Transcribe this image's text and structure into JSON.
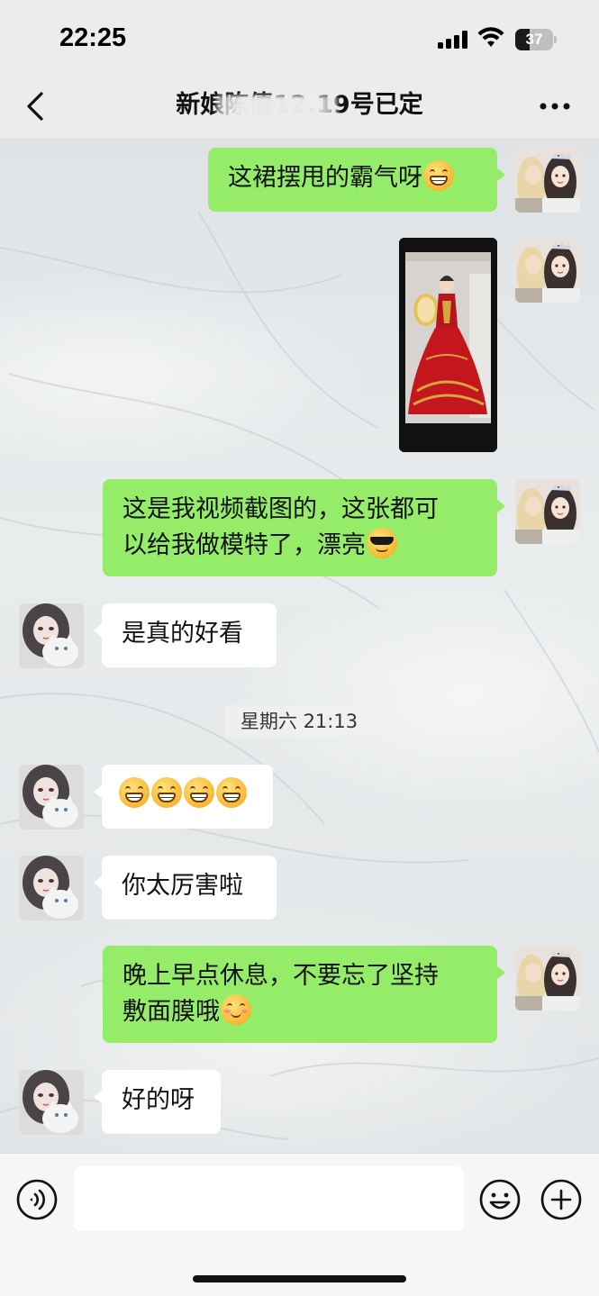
{
  "status_bar": {
    "time": "22:25",
    "battery": "37",
    "battery_level": 0.37
  },
  "header": {
    "title": "新娘陈倩12.19号已定"
  },
  "messages": [
    {
      "side": "me",
      "text": "这裙摆甩的霸气呀",
      "emoji": "grinning-face"
    },
    {
      "side": "me",
      "type": "image",
      "image_desc": "red-wedding-dress-photo"
    },
    {
      "side": "me",
      "line1": "这是我视频截图的，这张都可",
      "line2": "以给我做模特了，漂亮",
      "emoji": "sunglasses-face"
    },
    {
      "side": "them",
      "text": "是真的好看"
    },
    {
      "side": "them",
      "emoji_count": 4,
      "emoji": "grinning-face"
    },
    {
      "side": "them",
      "text": "你太厉害啦"
    },
    {
      "side": "me",
      "line1": "晚上早点休息，不要忘了坚持",
      "line2": "敷面膜哦",
      "emoji": "smiling-face"
    },
    {
      "side": "them",
      "text": "好的呀"
    }
  ],
  "timestamp": "星期六 21:13",
  "input": {
    "value": "",
    "placeholder": ""
  },
  "colors": {
    "my_bubble": "#95ec69",
    "their_bubble": "#ffffff",
    "nav_bg": "#ececec"
  },
  "icons": {
    "back": "chevron-left-icon",
    "more": "more-dots-icon",
    "voice": "voice-icon",
    "emoji": "emoji-icon",
    "plus": "plus-icon"
  }
}
